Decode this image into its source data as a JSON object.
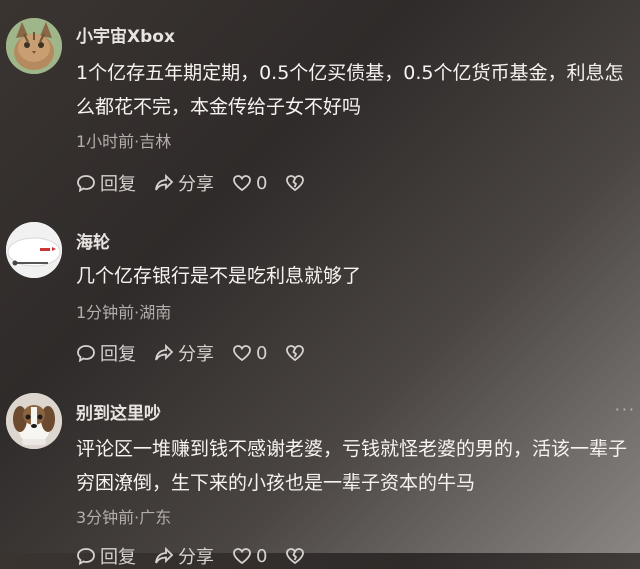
{
  "comments": [
    {
      "username": "小宇宙Xbox",
      "text": "1个亿存五年期定期，0.5个亿买债基，0.5个亿货币基金，利息怎么都花不完，本金传给子女不好吗",
      "meta": "1小时前·吉林",
      "reply_label": "回复",
      "share_label": "分享",
      "like_count": "0",
      "avatar": "cat-avatar"
    },
    {
      "username": "海轮",
      "text": "几个亿存银行是不是吃利息就够了",
      "meta": "1分钟前·湖南",
      "reply_label": "回复",
      "share_label": "分享",
      "like_count": "0",
      "avatar": "white-object-avatar"
    },
    {
      "username": "别到这里吵",
      "text": "评论区一堆赚到钱不感谢老婆，亏钱就怪老婆的男的，活该一辈子穷困潦倒，生下来的小孩也是一辈子资本的牛马",
      "meta": "3分钟前·广东",
      "reply_label": "回复",
      "share_label": "分享",
      "like_count": "0",
      "avatar": "dog-avatar"
    }
  ],
  "more_icon": "more-dots-icon"
}
